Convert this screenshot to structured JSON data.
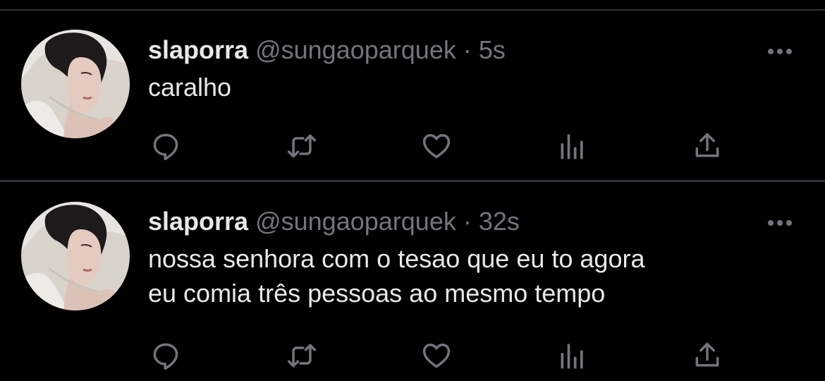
{
  "theme": {
    "background": "#000000",
    "text_primary": "#e7e9ea",
    "text_secondary": "#71767b",
    "divider": "#2f3336"
  },
  "tweets": [
    {
      "display_name": "slaporra",
      "handle": "@sungaoparquek",
      "separator": "·",
      "time": "5s",
      "text_lines": [
        "caralho"
      ],
      "actions": [
        "reply-icon",
        "retweet-icon",
        "like-icon",
        "views-icon",
        "share-icon"
      ],
      "more_icon": "more-horizontal-icon"
    },
    {
      "display_name": "slaporra",
      "handle": "@sungaoparquek",
      "separator": "·",
      "time": "32s",
      "text_lines": [
        "nossa senhora com o tesao que eu to agora",
        "eu comia três pessoas ao mesmo tempo"
      ],
      "actions": [
        "reply-icon",
        "retweet-icon",
        "like-icon",
        "views-icon",
        "share-icon"
      ],
      "more_icon": "more-horizontal-icon"
    }
  ]
}
